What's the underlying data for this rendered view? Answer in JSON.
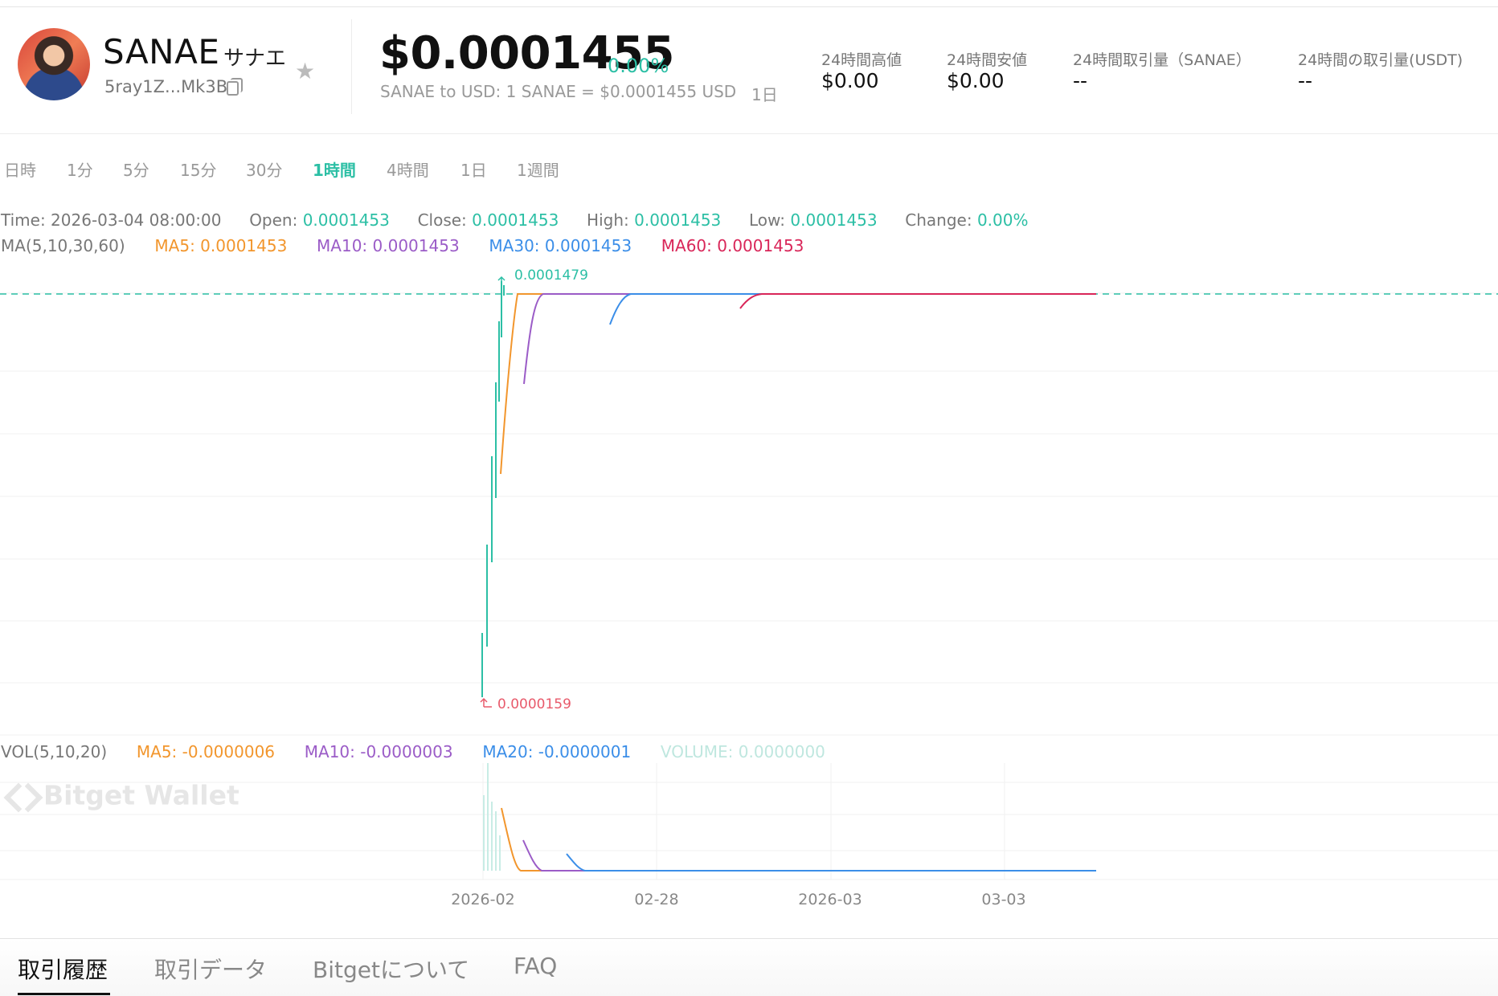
{
  "header": {
    "token_name": "SANAE",
    "token_name_jp": "サナエ",
    "address": "5ray1Z...Mk3B",
    "price": "$0.0001455",
    "price_change": "0.00%",
    "conversion": "SANAE to USD: 1 SANAE = $0.0001455 USD",
    "period": "1日",
    "stats": [
      {
        "label": "24時間高値",
        "value": "$0.00"
      },
      {
        "label": "24時間安値",
        "value": "$0.00"
      },
      {
        "label": "24時間取引量（SANAE）",
        "value": "--"
      },
      {
        "label": "24時間の取引量(USDT)",
        "value": "--"
      }
    ]
  },
  "timeframes": [
    "日時",
    "1分",
    "5分",
    "15分",
    "30分",
    "1時間",
    "4時間",
    "1日",
    "1週間"
  ],
  "active_timeframe": "1時間",
  "ohlc": {
    "time_label": "Time:",
    "time": "2026-03-04 08:00:00",
    "open_label": "Open:",
    "open": "0.0001453",
    "close_label": "Close:",
    "close": "0.0001453",
    "high_label": "High:",
    "high": "0.0001453",
    "low_label": "Low:",
    "low": "0.0001453",
    "change_label": "Change:",
    "change": "0.00%"
  },
  "ma": {
    "title": "MA(5,10,30,60)",
    "ma5": "MA5: 0.0001453",
    "ma10": "MA10: 0.0001453",
    "ma30": "MA30: 0.0001453",
    "ma60": "MA60: 0.0001453"
  },
  "chart_data": {
    "type": "line",
    "max_marker": "0.0001479",
    "min_marker": "0.0000159",
    "x_ticks": [
      "2026-02",
      "02-28",
      "2026-03",
      "03-03"
    ],
    "price_range": [
      1.59e-05,
      0.0001479
    ],
    "last_price": 0.0001453
  },
  "vol": {
    "title": "VOL(5,10,20)",
    "ma5": "MA5: -0.0000006",
    "ma10": "MA10: -0.0000003",
    "ma20": "MA20: -0.0000001",
    "volume": "VOLUME: 0.0000000"
  },
  "watermark": "Bitget Wallet",
  "bottom_tabs": [
    "取引履歴",
    "取引データ",
    "Bitgetについて",
    "FAQ"
  ],
  "colors": {
    "up": "#2cbfa5",
    "ma5": "#f2962d",
    "ma10": "#9b5cc7",
    "ma30": "#3b8ee8",
    "ma60": "#d92659",
    "down": "#e85a6b"
  }
}
